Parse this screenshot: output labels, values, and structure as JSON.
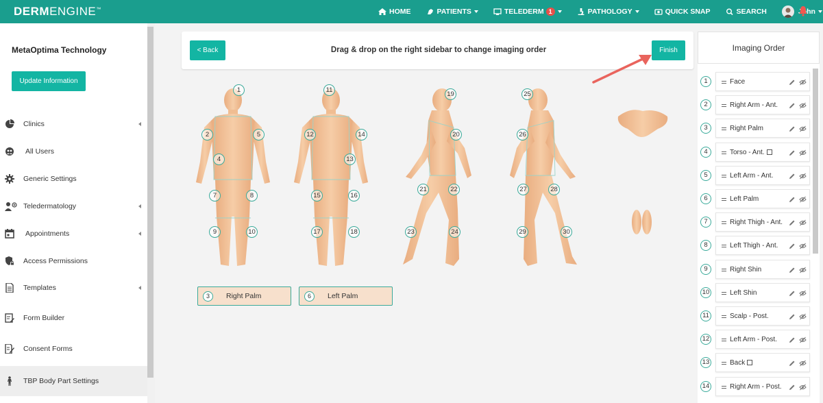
{
  "app": {
    "logo_bold": "DERM",
    "logo_thin": "ENGINE",
    "logo_tm": "™"
  },
  "nav": {
    "home": "HOME",
    "patients": "PATIENTS",
    "telederm": "TELEDERM",
    "telederm_badge": "1",
    "pathology": "PATHOLOGY",
    "quick_snap": "QUICK SNAP",
    "search": "SEARCH",
    "user": "John"
  },
  "sidebar": {
    "org_name": "MetaOptima Technology",
    "update_button": "Update Information",
    "items": [
      {
        "label": "Clinics",
        "icon": "pie-chart-icon",
        "arrow": true
      },
      {
        "label": "All Users",
        "icon": "users-globe-icon",
        "arrow": false
      },
      {
        "label": "Generic Settings",
        "icon": "gear-icon",
        "arrow": false
      },
      {
        "label": "Teledermatology",
        "icon": "doctor-icon",
        "arrow": true
      },
      {
        "label": "Appointments",
        "icon": "calendar-icon",
        "arrow": true
      },
      {
        "label": "Access Permissions",
        "icon": "shield-icon",
        "arrow": false
      },
      {
        "label": "Templates",
        "icon": "document-icon",
        "arrow": true
      },
      {
        "label": "Form Builder",
        "icon": "form-icon",
        "arrow": false
      },
      {
        "label": "Consent Forms",
        "icon": "edit-document-icon",
        "arrow": false
      },
      {
        "label": "TBP Body Part Settings",
        "icon": "body-icon",
        "arrow": false
      }
    ]
  },
  "toolbar": {
    "back": "< Back",
    "message": "Drag & drop on the right sidebar to change imaging order",
    "finish": "Finish"
  },
  "figure_markers": [
    "1",
    "2",
    "4",
    "5",
    "7",
    "8",
    "9",
    "10",
    "11",
    "12",
    "13",
    "14",
    "15",
    "16",
    "17",
    "18",
    "19",
    "20",
    "21",
    "22",
    "23",
    "24",
    "25",
    "26",
    "27",
    "28",
    "29",
    "30"
  ],
  "chips": [
    {
      "num": "3",
      "label": "Right Palm"
    },
    {
      "num": "6",
      "label": "Left Palm"
    }
  ],
  "imaging_order": {
    "title": "Imaging Order",
    "items": [
      {
        "num": "1",
        "label": "Face",
        "copy": false
      },
      {
        "num": "2",
        "label": "Right Arm - Ant.",
        "copy": false
      },
      {
        "num": "3",
        "label": "Right Palm",
        "copy": false
      },
      {
        "num": "4",
        "label": "Torso - Ant.",
        "copy": true
      },
      {
        "num": "5",
        "label": "Left Arm - Ant.",
        "copy": false
      },
      {
        "num": "6",
        "label": "Left Palm",
        "copy": false
      },
      {
        "num": "7",
        "label": "Right Thigh - Ant.",
        "copy": false
      },
      {
        "num": "8",
        "label": "Left Thigh - Ant.",
        "copy": false
      },
      {
        "num": "9",
        "label": "Right Shin",
        "copy": false
      },
      {
        "num": "10",
        "label": "Left Shin",
        "copy": false
      },
      {
        "num": "11",
        "label": "Scalp - Post.",
        "copy": false
      },
      {
        "num": "12",
        "label": "Left Arm - Post.",
        "copy": false
      },
      {
        "num": "13",
        "label": "Back",
        "copy": true
      },
      {
        "num": "14",
        "label": "Right Arm - Post.",
        "copy": false
      }
    ]
  },
  "colors": {
    "nav_bg": "#1a9e8e",
    "accent": "#13b5a3",
    "badge": "#e6514a",
    "skin": "#f3c49c",
    "chip_bg": "#f7e0cc",
    "arrow": "#e9645d"
  }
}
